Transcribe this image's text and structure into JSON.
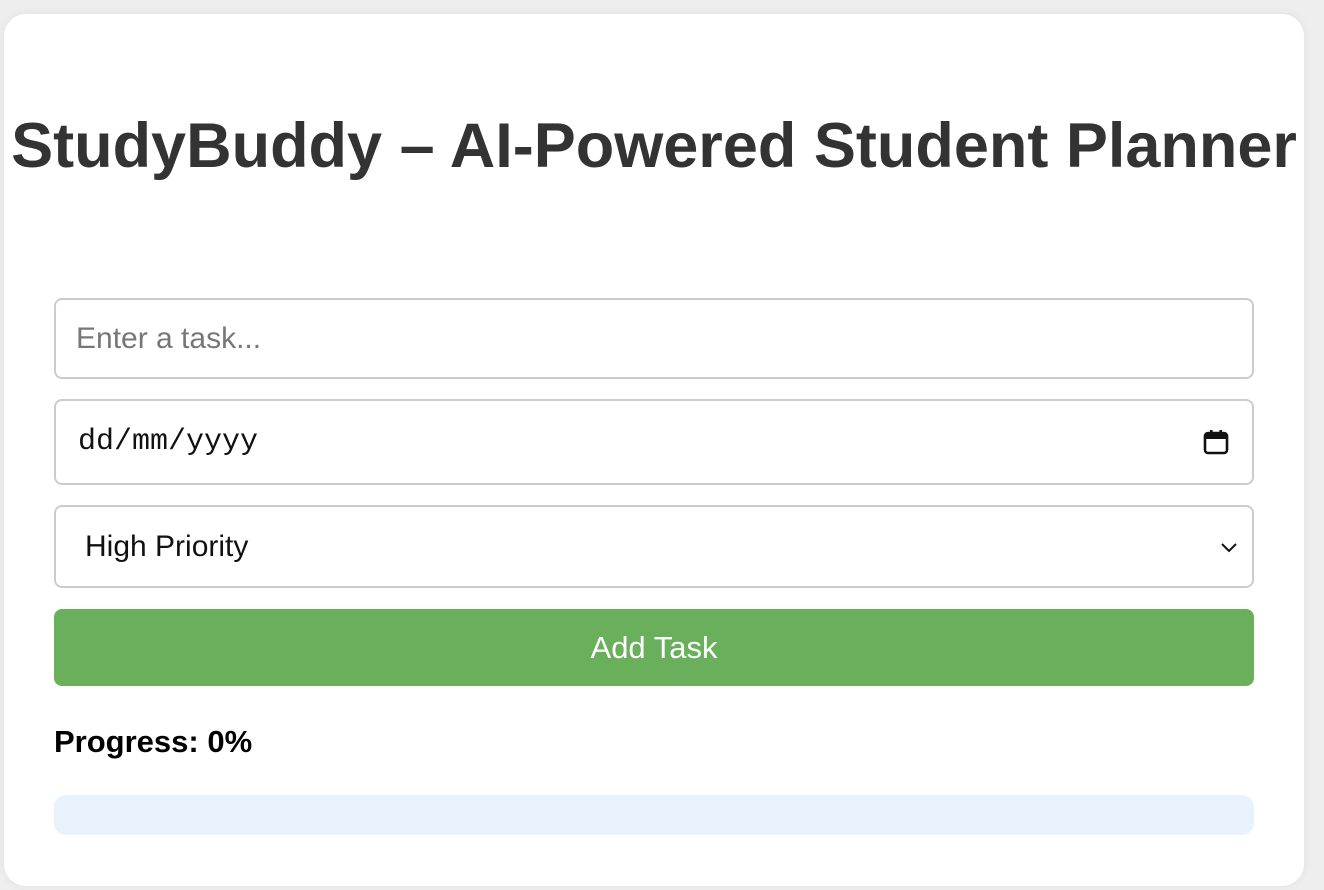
{
  "app": {
    "title": "StudyBuddy – AI-Powered Student Planner"
  },
  "form": {
    "task_placeholder": "Enter a task...",
    "task_value": "",
    "date_placeholder": "dd/mm/yyyy",
    "date_icon": "calendar-icon",
    "priority_selected": "High Priority",
    "priority_icon": "chevron-down-icon",
    "add_button_label": "Add Task"
  },
  "progress": {
    "label": "Progress: 0%",
    "value_percent": 0
  },
  "colors": {
    "accent_green": "#6aaf5c",
    "title_text": "#333333",
    "progress_track": "#e8f2fc",
    "field_border": "#cccccc"
  }
}
